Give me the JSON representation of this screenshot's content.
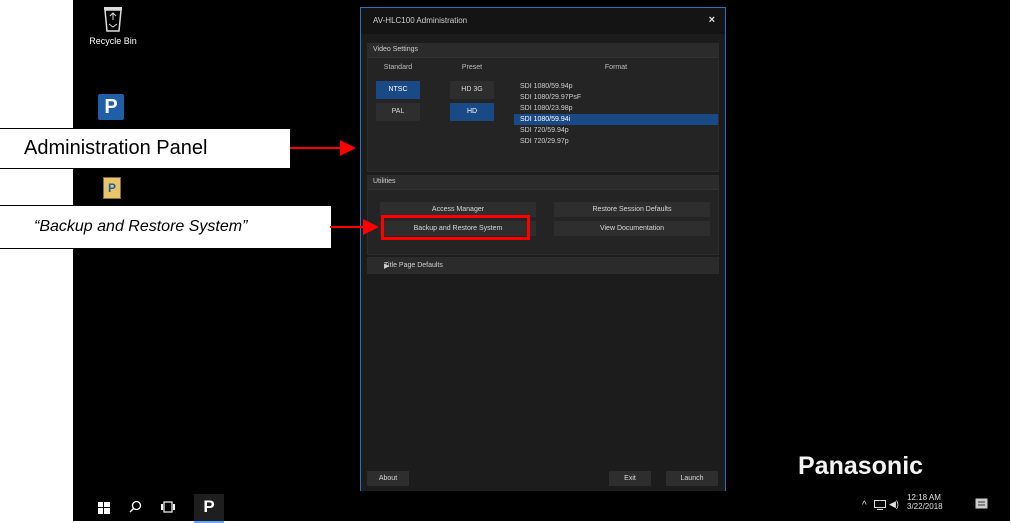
{
  "desktop": {
    "recycle_bin_label": "Recycle Bin",
    "app_icon_letter": "P"
  },
  "window": {
    "title": "AV-HLC100 Administration",
    "close_glyph": "×",
    "video_settings": {
      "header": "Video Settings",
      "columns": {
        "standard": "Standard",
        "preset": "Preset",
        "format": "Format"
      },
      "standards": [
        {
          "label": "NTSC",
          "selected": true
        },
        {
          "label": "PAL",
          "selected": false
        }
      ],
      "presets": [
        {
          "label": "HD 3G",
          "selected": false
        },
        {
          "label": "HD",
          "selected": true
        }
      ],
      "formats": [
        {
          "label": "SDI 1080/59.94p",
          "selected": false
        },
        {
          "label": "SDI 1080/29.97PsF",
          "selected": false
        },
        {
          "label": "SDI 1080/23.98p",
          "selected": false
        },
        {
          "label": "SDI 1080/59.94i",
          "selected": true
        },
        {
          "label": "SDI 720/59.94p",
          "selected": false
        },
        {
          "label": "SDI 720/29.97p",
          "selected": false
        }
      ]
    },
    "utilities": {
      "header": "Utilities",
      "access_manager": "Access Manager",
      "restore_session_defaults": "Restore Session Defaults",
      "backup_restore": "Backup and Restore System",
      "view_documentation": "View Documentation"
    },
    "title_page_defaults": "Title Page Defaults",
    "footer": {
      "about": "About",
      "exit": "Exit",
      "launch": "Launch"
    }
  },
  "annotations": {
    "admin_panel": "Administration Panel",
    "backup_callout": "“Backup and Restore System”",
    "arrow_color": "#ff0000"
  },
  "brand": {
    "logo_text": "Panasonic"
  },
  "taskbar": {
    "clock_time": "12:18 AM",
    "clock_date": "3/22/2018",
    "app_letter": "P"
  },
  "colors": {
    "accent": "#1a4a85",
    "window_border": "#2f6fbf",
    "highlight": "#ff0000"
  }
}
